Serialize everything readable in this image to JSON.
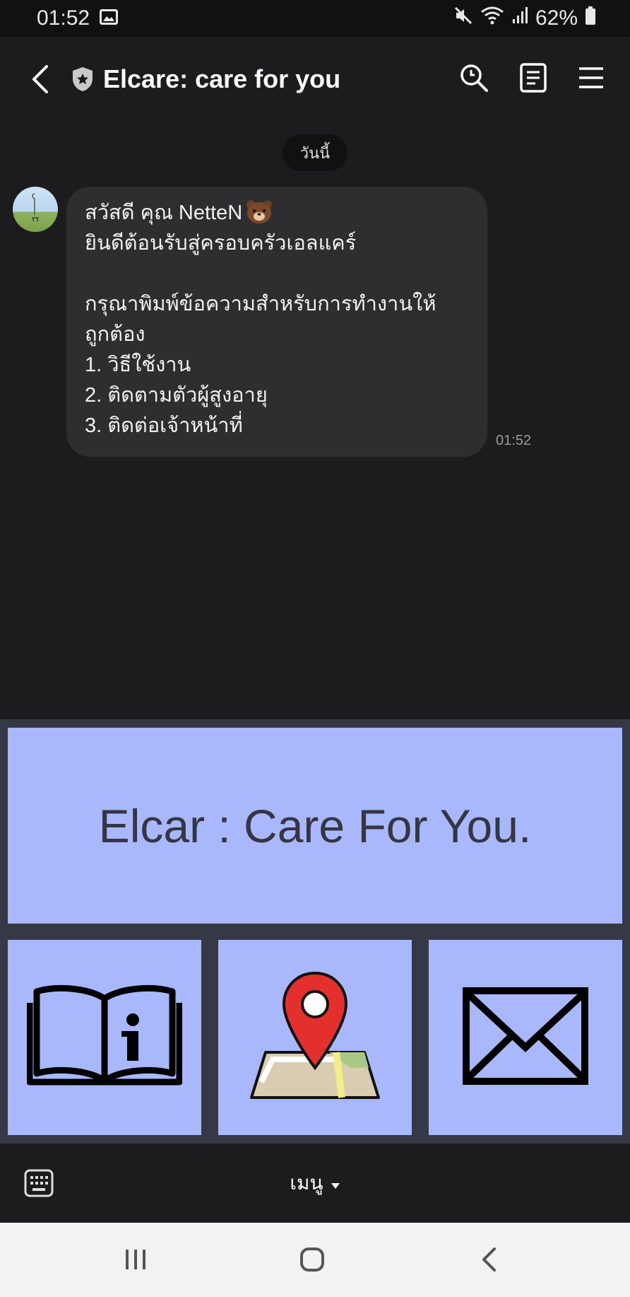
{
  "status_bar": {
    "time": "01:52",
    "battery": "62%",
    "icons": [
      "image-icon",
      "mute-icon",
      "wifi-icon",
      "signal-icon",
      "battery-icon"
    ]
  },
  "header": {
    "title": "Elcare: care for you",
    "icons": [
      "back-icon",
      "shield-star-icon",
      "search-icon",
      "notes-icon",
      "menu-icon"
    ]
  },
  "chat": {
    "date_label": "วันนี้",
    "message": {
      "lines": [
        "สวัสดี คุณ NetteN",
        "ยินดีต้อนรับสู่ครอบครัวเอลแคร์",
        "",
        "กรุณาพิมพ์ข้อความสำหรับการทำงานให้",
        "ถูกต้อง",
        "1. วิธีใช้งาน",
        "2. ติดตามตัวผู้สูงอายุ",
        "3. ติดต่อเจ้าหน้าที่"
      ],
      "time": "01:52"
    }
  },
  "rich_menu": {
    "banner": "Elcar : Care For You.",
    "buttons": [
      {
        "icon": "book-info-icon"
      },
      {
        "icon": "map-pin-icon"
      },
      {
        "icon": "envelope-icon"
      }
    ],
    "colors": {
      "tile": "#a9b8fc",
      "background": "#353845",
      "pin": "#e4302d"
    }
  },
  "bottom_bar": {
    "menu_label": "เมนู"
  }
}
